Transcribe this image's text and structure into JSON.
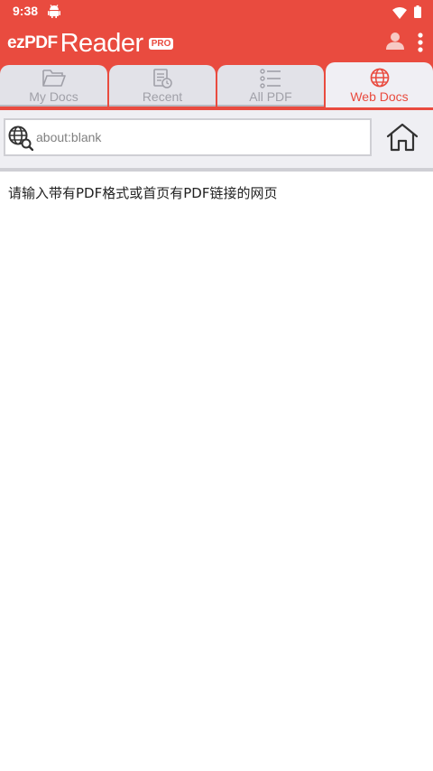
{
  "status": {
    "time": "9:38"
  },
  "app": {
    "logo_ez": "ezPDF",
    "logo_reader": "Reader",
    "logo_pro": "PRO"
  },
  "tabs": [
    {
      "label": "My Docs"
    },
    {
      "label": "Recent"
    },
    {
      "label": "All PDF"
    },
    {
      "label": "Web Docs"
    }
  ],
  "active_tab": "Web Docs",
  "url": {
    "value": "about:blank"
  },
  "content": {
    "message": "请输入带有PDF格式或首页有PDF链接的网页"
  },
  "colors": {
    "accent": "#e94b3f",
    "tab_bg": "#e2e2e8",
    "toolbar_bg": "#efeff3"
  }
}
